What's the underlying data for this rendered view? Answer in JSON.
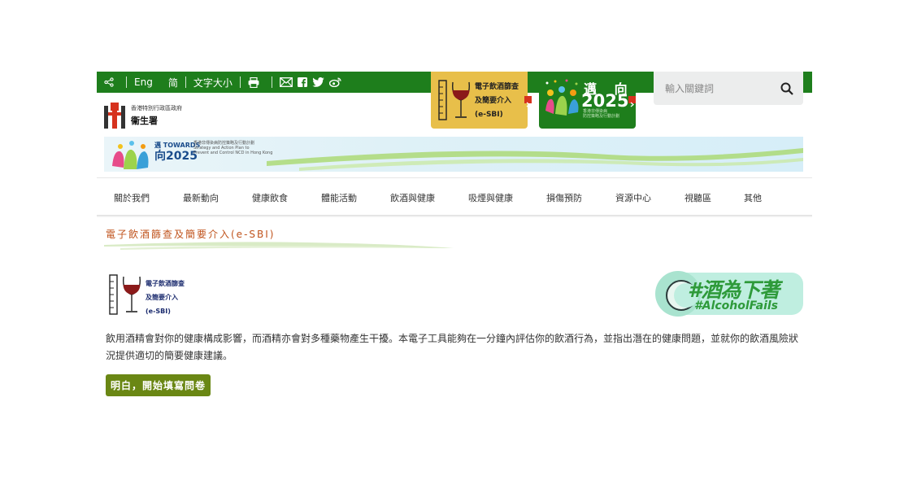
{
  "topbar": {
    "lang_eng": "Eng",
    "lang_sc": "简",
    "font_size": "文字大小",
    "icons": [
      "share-icon",
      "print-icon",
      "email-icon",
      "facebook-icon",
      "twitter-icon",
      "weibo-icon"
    ]
  },
  "promo": {
    "esbi_line1": "電子飲酒篩查",
    "esbi_line2": "及簡要介入",
    "esbi_line3": "(e-SBI)",
    "towards_top": "邁 向",
    "towards_year": "2025",
    "towards_sub1": "香港非傳染病",
    "towards_sub2": "防控策略及行動計劃"
  },
  "search": {
    "placeholder": "輸入關鍵詞"
  },
  "logo": {
    "line1": "香港特別行政區政府",
    "line2": "衞生署"
  },
  "banner": {
    "towards_en": "邁 TOWARDS",
    "year": "向2025",
    "desc1": "香港非傳染病防控策略及行動計劃",
    "desc2": "Strategy and Action Plan to",
    "desc3": "Prevent and Control NCD in Hong Kong"
  },
  "nav": {
    "items": [
      "關於我們",
      "最新動向",
      "健康飲食",
      "體能活動",
      "飲酒與健康",
      "吸煙與健康",
      "損傷預防",
      "資源中心",
      "視聽區",
      "其他"
    ]
  },
  "page": {
    "title": "電子飲酒篩查及簡要介入(e-SBI)",
    "esbi_line1": "電子飲酒篩查",
    "esbi_line2": "及簡要介入",
    "esbi_line3": "(e-SBI)",
    "campaign_cn": "#酒為下著",
    "campaign_en": "#AlcoholFails",
    "intro": "飲用酒精會對你的健康構成影響，而酒精亦會對多種藥物產生干擾。本電子工具能夠在一分鐘內評估你的飲酒行為，並指出潛在的健康問題，並就你的飲酒風險狀況提供適切的簡要健康建議。",
    "start_button": "明白，開始填寫問卷"
  },
  "colors": {
    "brand_green": "#1e7e1c",
    "esbi_yellow": "#e8bf4a",
    "title_orange": "#c0531c",
    "button_olive": "#6a8714",
    "arrow_red": "#d6321e"
  }
}
